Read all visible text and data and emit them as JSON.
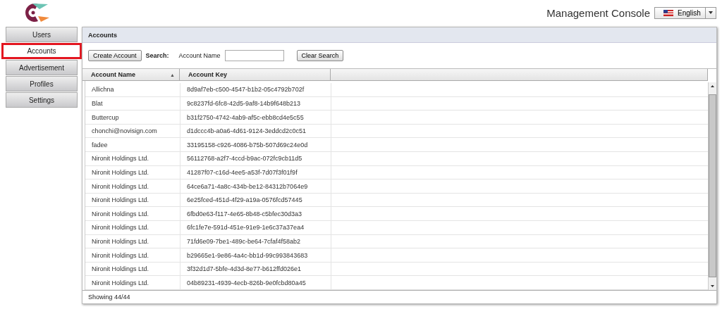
{
  "header": {
    "title": "Management Console",
    "language": "English"
  },
  "sidebar": {
    "items": [
      {
        "label": "Users",
        "selected": false
      },
      {
        "label": "Accounts",
        "selected": true
      },
      {
        "label": "Advertisement",
        "selected": false
      },
      {
        "label": "Profiles",
        "selected": false
      },
      {
        "label": "Settings",
        "selected": false
      }
    ]
  },
  "panel": {
    "title": "Accounts"
  },
  "toolbar": {
    "create_button": "Create Account",
    "search_label": "Search:",
    "field_label": "Account Name",
    "clear_button": "Clear Search"
  },
  "table": {
    "columns": [
      {
        "label": "Account Name",
        "sort": "▲"
      },
      {
        "label": "Account Key"
      }
    ],
    "rows": [
      [
        "Allichna",
        "8d9af7eb-c500-4547-b1b2-05c4792b702f"
      ],
      [
        "Blat",
        "9c8237fd-6fc8-42d5-9af8-14b9f648b213"
      ],
      [
        "Buttercup",
        "b31f2750-4742-4ab9-af5c-ebb8cd4e5c55"
      ],
      [
        "chonchi@novisign.com",
        "d1dccc4b-a0a6-4d61-9124-3eddcd2c0c51"
      ],
      [
        "fadee",
        "33195158-c926-4086-b75b-507d69c24e0d"
      ],
      [
        "Nironit Holdings Ltd.",
        "56112768-a2f7-4ccd-b9ac-072fc9cb11d5"
      ],
      [
        "Nironit Holdings Ltd.",
        "41287f07-c16d-4ee5-a53f-7d07f3f01f9f"
      ],
      [
        "Nironit Holdings Ltd.",
        "64ce6a71-4a8c-434b-be12-84312b7064e9"
      ],
      [
        "Nironit Holdings Ltd.",
        "6e25fced-451d-4f29-a19a-0576fcd57445"
      ],
      [
        "Nironit Holdings Ltd.",
        "6fbd0e63-f117-4e65-8b48-c5bfec30d3a3"
      ],
      [
        "Nironit Holdings Ltd.",
        "6fc1fe7e-591d-451e-91e9-1e6c37a37ea4"
      ],
      [
        "Nironit Holdings Ltd.",
        "71fd6e09-7be1-489c-be64-7cfaf4f58ab2"
      ],
      [
        "Nironit Holdings Ltd.",
        "b29665e1-9e86-4a4c-bb1d-99c993843683"
      ],
      [
        "Nironit Holdings Ltd.",
        "3f32d1d7-5bfe-4d3d-8e77-b612ffd026e1"
      ],
      [
        "Nironit Holdings Ltd.",
        "04b89231-4939-4ecb-826b-9e0fcbd80a45"
      ]
    ]
  },
  "footer": {
    "status": "Showing 44/44"
  }
}
